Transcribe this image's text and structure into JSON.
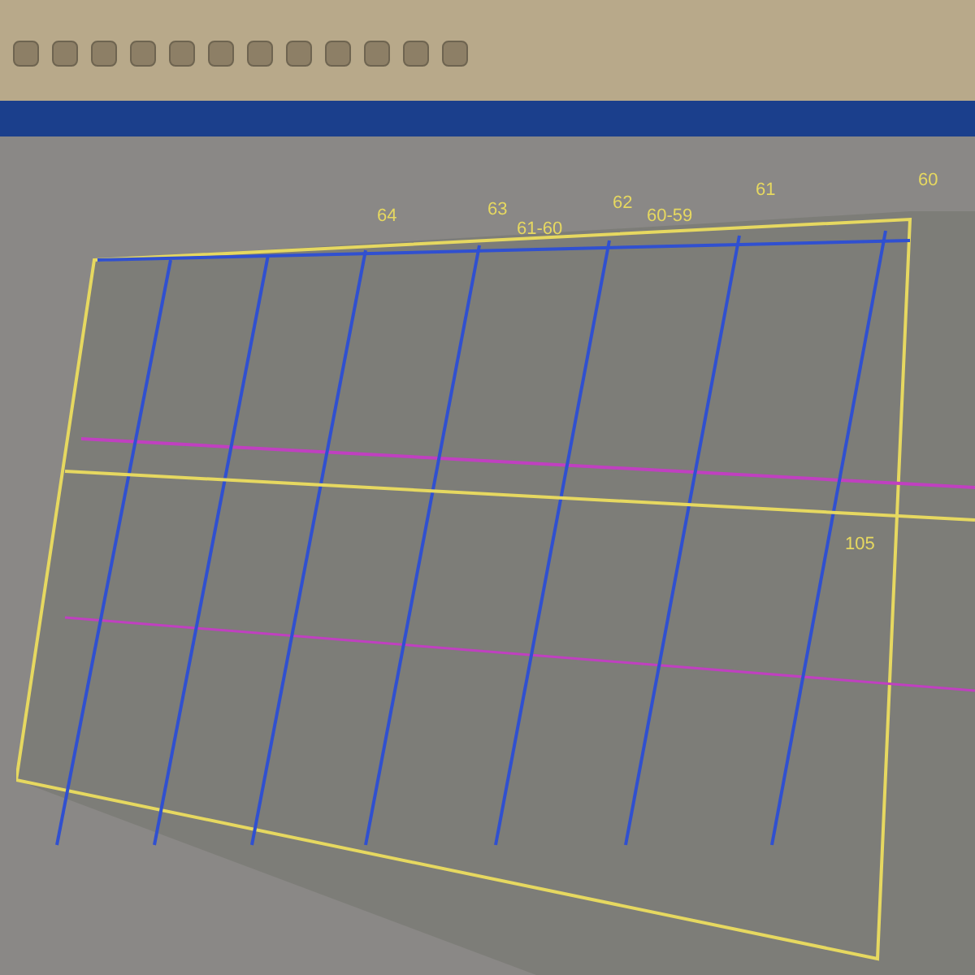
{
  "map": {
    "strip_labels": [
      "64",
      "63",
      "61-60",
      "62",
      "60-59",
      "61",
      "60"
    ],
    "inner_label": "105"
  }
}
